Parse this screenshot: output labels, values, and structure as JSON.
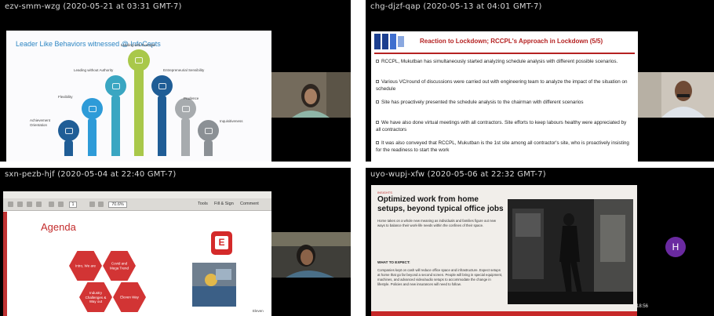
{
  "panels": [
    {
      "title": "ezv-smm-wzg (2020-05-21 at 03:31 GMT-7)",
      "slide": {
        "title": "Leader Like Behaviors witnessed @ InfoCepts",
        "labels": [
          "Leading with Example",
          "Leading without Authority",
          "Entrepreneurial Sensibility",
          "Flexibility",
          "Prudence",
          "Achievement Orientation",
          "Inquisitiveness"
        ]
      }
    },
    {
      "title": "chg-djzf-qap (2020-05-13 at 04:01 GMT-7)",
      "slide": {
        "title": "Reaction to Lockdown; RCCPL's Approach in Lockdown (5/5)",
        "bullets": [
          "RCCPL, Mukutban has simultaneously started analyzing schedule analysis with different possible scenarios.",
          "Various VC/round of discussions were carried out with engineering team to analyze the impact of the situation on schedule",
          "Site has proactively presented the schedule analysis to the chairman with different scenarios",
          "We have also done virtual meetings with all contractors. Site efforts to keep labours healthy were appreciated by all contractors",
          "It was also conveyed that RCCPL, Mukutban is the 1st site among all contractor's site, who is proactively insisting for the readiness to start the work"
        ]
      }
    },
    {
      "title": "sxn-pezb-hjf (2020-05-04 at 22:40 GMT-7)",
      "toolbar": {
        "page": "1",
        "zoom": "70.6%",
        "tools": "Tools",
        "fill_sign": "Fill & Sign",
        "comment": "Comment"
      },
      "slide": {
        "title": "Agenda",
        "hexagons": [
          "Intro, We are",
          "Covid and Mega Trend",
          "Industry Challenges & Way out",
          "Eleven Way"
        ],
        "logo_letter": "E",
        "footer": "Eleven"
      }
    },
    {
      "title": "uyo-wupj-xfw (2020-05-06 at 22:32 GMT-7)",
      "slide": {
        "eyebrow": "INSIGHTS",
        "title": "Optimized work from home setups, beyond typical office jobs",
        "body1": "Home takes on a whole new meaning as individuals and families figure out new ways to balance their work-life needs within the confines of their space.",
        "subheading": "WHAT TO EXPECT:",
        "body2": "Companies kept on cash will reduce office space and infrastructure. Expect setups at home that go far beyond a second screen. People will bring in special equipment, machines, and advanced video/audio setups to accommodate the change in lifestyle. Policies and new insurances will need to follow."
      },
      "avatar_letter": "H",
      "timestamp": "1:18:56"
    }
  ]
}
